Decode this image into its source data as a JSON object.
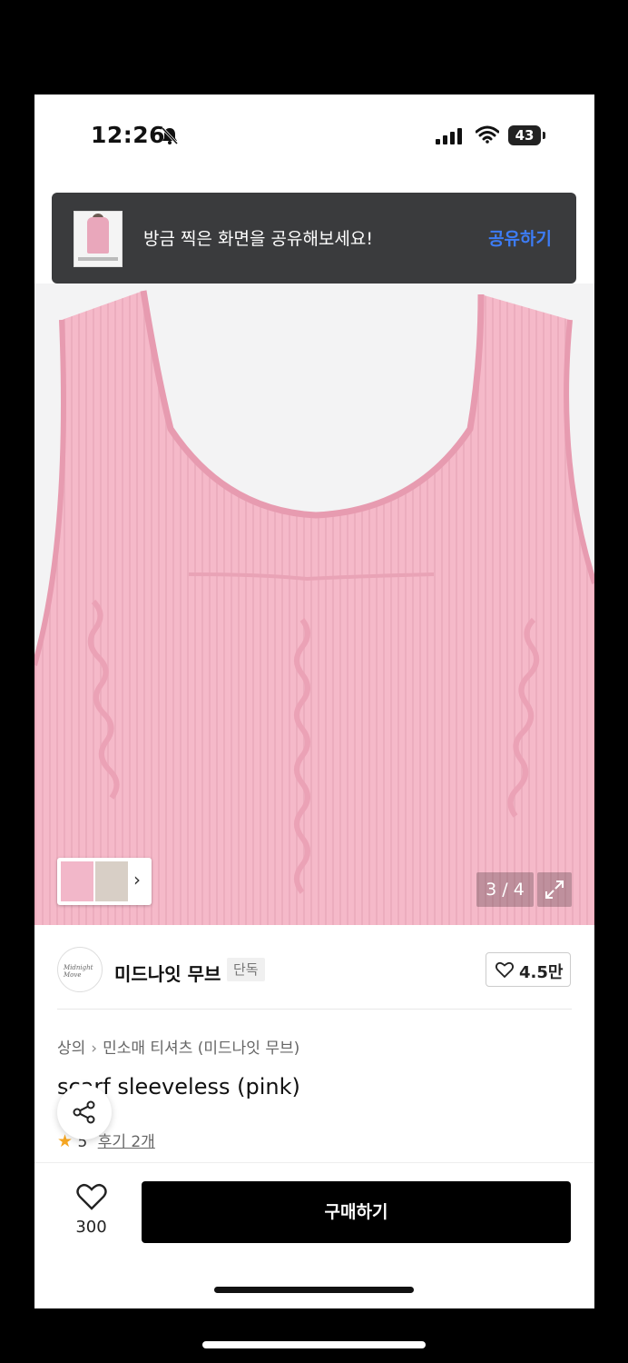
{
  "status_bar": {
    "time": "12:26",
    "battery": "43"
  },
  "share_banner": {
    "text": "방금 찍은 화면을 공유해보세요!",
    "action": "공유하기"
  },
  "gallery": {
    "page_indicator": "3 / 4",
    "current_page": 3,
    "total_pages": 4
  },
  "store": {
    "name": "미드나잇 무브",
    "badge": "단독",
    "likes": "4.5만"
  },
  "product": {
    "breadcrumb": [
      "상의",
      "민소매 티셔츠 (미드나잇 무브)"
    ],
    "title": "scarf sleeveless (pink)",
    "rating": "5",
    "reviews": "후기 2개"
  },
  "bottom_bar": {
    "wish_count": "300",
    "buy_label": "구매하기"
  },
  "colors": {
    "accent_blue": "#3d7cf5",
    "banner_bg": "#3a3b3d",
    "garment_pink": "#f4b8c8",
    "star": "#f5a623"
  },
  "icons": [
    "bell-slash-icon",
    "signal-icon",
    "wifi-icon",
    "chevron-right-icon",
    "expand-icon",
    "heart-icon",
    "share-icon",
    "star-icon"
  ]
}
